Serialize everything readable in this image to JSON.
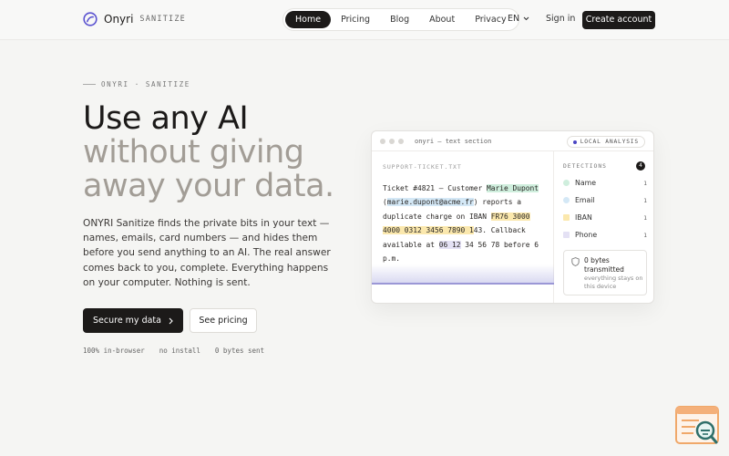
{
  "brand": {
    "name": "Onyri",
    "sub": "SANITIZE"
  },
  "nav": {
    "items": [
      {
        "label": "Home",
        "active": true
      },
      {
        "label": "Pricing",
        "active": false
      },
      {
        "label": "Blog",
        "active": false
      },
      {
        "label": "About",
        "active": false
      },
      {
        "label": "Privacy",
        "active": false
      }
    ]
  },
  "header": {
    "lang": "EN",
    "signin": "Sign in",
    "create": "Create account"
  },
  "hero": {
    "eyebrow": "ONYRI · SANITIZE",
    "title_line1": "Use any AI",
    "title_line2": "without giving",
    "title_line3": "away your data.",
    "lead": "ONYRI Sanitize finds the private bits in your text — names, emails, card numbers — and hides them before you send anything to an AI. The real answer comes back to you, complete. Everything happens on your computer. Nothing is sent.",
    "cta_primary": "Secure my data",
    "cta_secondary": "See pricing",
    "meta": [
      "100% in-browser",
      "no install",
      "0 bytes sent"
    ]
  },
  "demo": {
    "window_title": "onyri — text section",
    "badge": "LOCAL ANALYSIS",
    "file": "SUPPORT-TICKET.TXT",
    "ticket": {
      "p1": "Ticket #4821 — Customer ",
      "name": "Marie Dupont",
      "p2": " (",
      "email": "marie.dupont@acme.fr",
      "p3": ") reports a duplicate charge on IBAN ",
      "iban": "FR76 3000 4000 0312 3456 7890 1",
      "p4": "43. Callback available at ",
      "phone": "06 12",
      "p5": " 34 56 78 before 6 p.m."
    },
    "detections": {
      "title": "DETECTIONS",
      "count": "4",
      "items": [
        {
          "label": "Name",
          "count": "1",
          "color": "#cfeedd"
        },
        {
          "label": "Email",
          "count": "1",
          "color": "#d4e8f6"
        },
        {
          "label": "IBAN",
          "count": "1",
          "color": "#fbe8ad"
        },
        {
          "label": "Phone",
          "count": "1",
          "color": "#e4e1f4"
        }
      ]
    },
    "bytes": {
      "title": "0 bytes transmitted",
      "sub": "everything stays on this device"
    }
  }
}
